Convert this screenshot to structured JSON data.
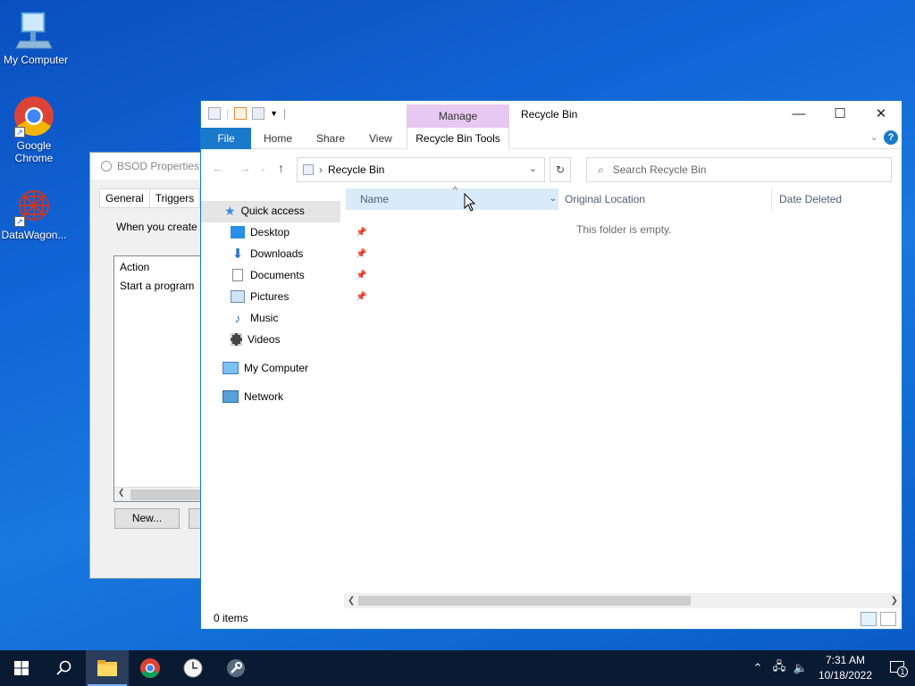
{
  "desktop": {
    "icons": [
      {
        "label": "My Computer",
        "icon": "computer-icon"
      },
      {
        "label": "Google Chrome",
        "icon": "chrome-icon"
      },
      {
        "label": "DataWagon...",
        "icon": "datawagon-icon"
      }
    ]
  },
  "bsod_window": {
    "title": "BSOD Properties (",
    "tabs": [
      "General",
      "Triggers"
    ],
    "description": "When you create a",
    "list_header": "Action",
    "list_rows": [
      "Start a program"
    ],
    "new_button": "New..."
  },
  "explorer": {
    "title": "Recycle Bin",
    "contextual_group": "Manage",
    "ribbon_tabs": {
      "file": "File",
      "home": "Home",
      "share": "Share",
      "view": "View",
      "tools": "Recycle Bin Tools"
    },
    "address": "Recycle Bin",
    "search_placeholder": "Search Recycle Bin",
    "nav": {
      "quick_access": "Quick access",
      "desktop": "Desktop",
      "downloads": "Downloads",
      "documents": "Documents",
      "pictures": "Pictures",
      "music": "Music",
      "videos": "Videos",
      "my_computer": "My Computer",
      "network": "Network"
    },
    "columns": {
      "name": "Name",
      "original_location": "Original Location",
      "date_deleted": "Date Deleted"
    },
    "empty_message": "This folder is empty.",
    "status": "0 items"
  },
  "taskbar": {
    "time": "7:31 AM",
    "date": "10/18/2022",
    "notification_count": "1"
  },
  "colors": {
    "accent": "#1979ca",
    "manage_tab": "#e6c8f0",
    "taskbar": "#0b1a33"
  }
}
